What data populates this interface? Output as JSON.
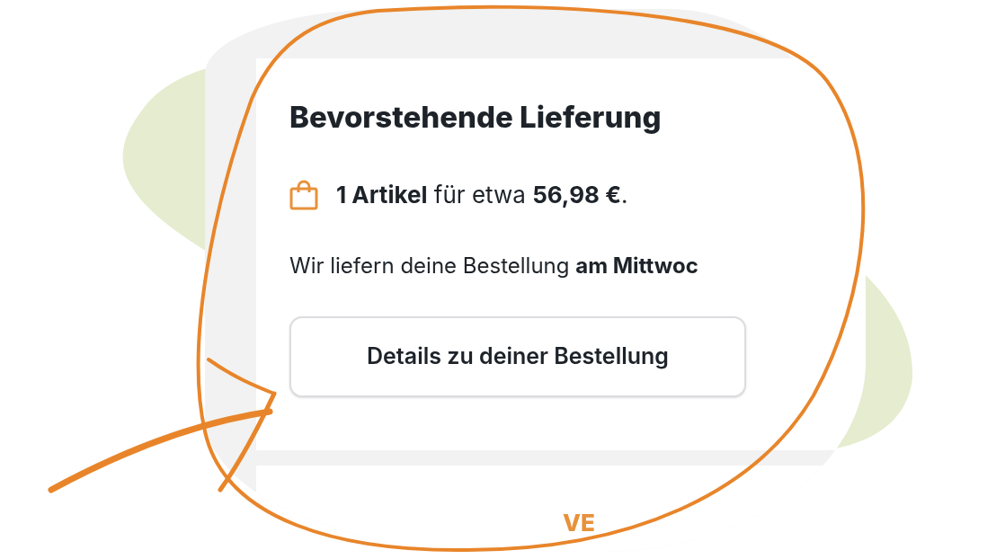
{
  "card": {
    "title": "Bevorstehende Lieferung",
    "summary": "**1 Artikel** für etwa **56,98 €**.",
    "delivery": "Wir liefern deine Bestellung **am Mittwoc**",
    "button": "Details zu deiner Bestellung"
  },
  "next_card": {
    "heading": "VE"
  }
}
